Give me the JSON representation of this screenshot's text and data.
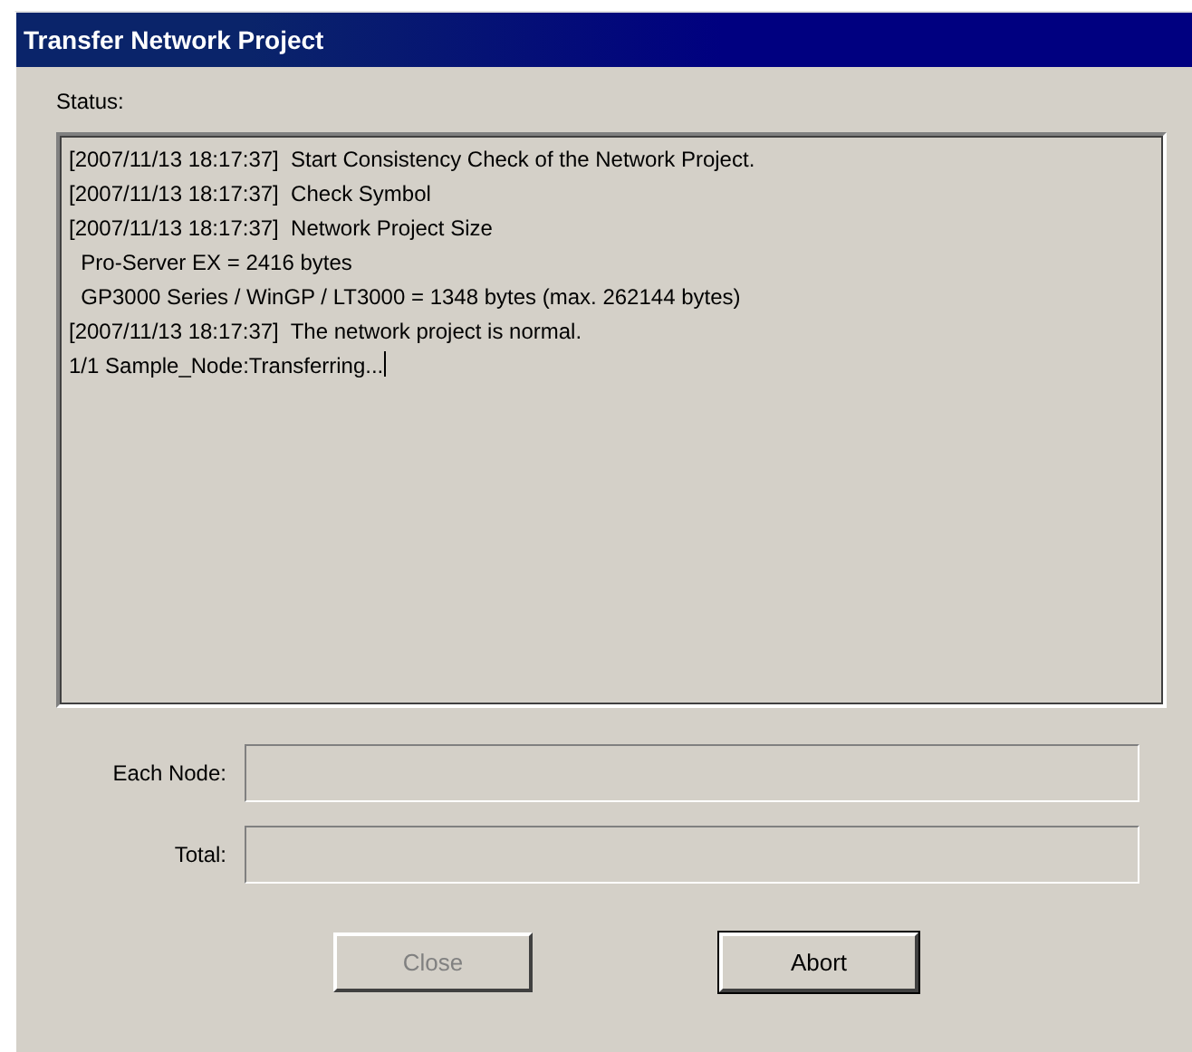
{
  "window": {
    "title": "Transfer Network Project"
  },
  "status": {
    "label": "Status:",
    "lines": [
      "[2007/11/13 18:17:37]  Start Consistency Check of the Network Project.",
      "[2007/11/13 18:17:37]  Check Symbol",
      "[2007/11/13 18:17:37]  Network Project Size",
      "  Pro-Server EX = 2416 bytes",
      "  GP3000 Series / WinGP / LT3000 = 1348 bytes (max. 262144 bytes)",
      "[2007/11/13 18:17:37]  The network project is normal.",
      "1/1 Sample_Node:Transferring..."
    ]
  },
  "progress": [
    {
      "label": "Each Node:",
      "level": 0
    },
    {
      "label": "Total:",
      "level": 0
    }
  ],
  "buttons": [
    {
      "label": "Close",
      "disabled": true
    },
    {
      "label": "Abort",
      "disabled": false
    }
  ]
}
